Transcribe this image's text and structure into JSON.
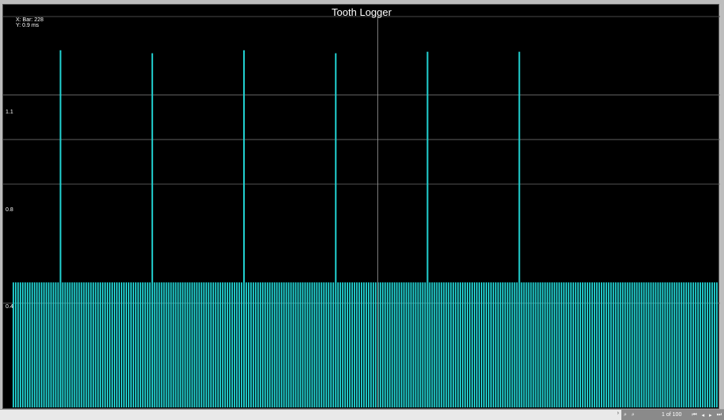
{
  "window": {
    "title": "Tooth Logger"
  },
  "readout": {
    "x_text": "X: Bar: 228",
    "y_text": "Y: 0.9 ms"
  },
  "colors": {
    "background": "#000000",
    "bars": "#22d3d3",
    "grid": "#6e6e6e",
    "text": "#ffffff"
  },
  "chart_data": {
    "type": "bar",
    "title": "Tooth Logger",
    "xlabel": "",
    "ylabel": "",
    "ylim": [
      0,
      1.35
    ],
    "yticks": [
      "1.1",
      "0.8",
      "0.4"
    ],
    "ytick_values": [
      1.1,
      0.8,
      0.4
    ],
    "grid": true,
    "bar_count": 300,
    "baseline_value": 0.47,
    "missing_tooth_bars": [
      20,
      59,
      98,
      137,
      176,
      215
    ],
    "missing_tooth_values": [
      1.25,
      1.24,
      1.25,
      1.24,
      1.245,
      1.245
    ],
    "cursor_bar": 155
  },
  "navigator": {
    "scroll_icon": "right-arrow-icon",
    "zoom_in_icon": "zoom-in-icon",
    "zoom_out_icon": "zoom-out-icon",
    "page": "1",
    "of_label": "of 100",
    "first_icon": "first-page-icon",
    "prev_icon": "prev-page-icon",
    "next_icon": "next-page-icon",
    "last_icon": "last-page-icon"
  }
}
